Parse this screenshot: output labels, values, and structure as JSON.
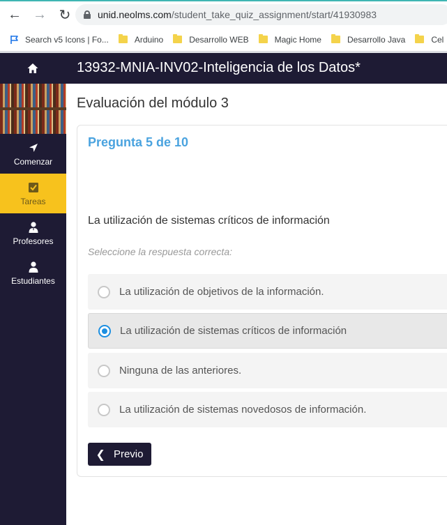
{
  "browser": {
    "url_host": "unid.neolms.com",
    "url_path": "/student_take_quiz_assignment/start/41930983",
    "bookmarks": [
      {
        "label": "Search v5 Icons | Fo...",
        "icon": "flag-icon"
      },
      {
        "label": "Arduino",
        "icon": "folder-icon"
      },
      {
        "label": "Desarrollo WEB",
        "icon": "folder-icon"
      },
      {
        "label": "Magic Home",
        "icon": "folder-icon"
      },
      {
        "label": "Desarrollo Java",
        "icon": "folder-icon"
      },
      {
        "label": "Cel",
        "icon": "folder-icon"
      }
    ]
  },
  "header": {
    "course_title": "13932-MNIA-INV02-Inteligencia de los Datos*"
  },
  "sidebar": {
    "items": [
      {
        "label": "Comenzar",
        "icon": "paper-plane-icon"
      },
      {
        "label": "Tareas",
        "icon": "checkbox-icon"
      },
      {
        "label": "Profesores",
        "icon": "teacher-icon"
      },
      {
        "label": "Estudiantes",
        "icon": "student-icon"
      }
    ]
  },
  "main": {
    "page_title": "Evaluación del módulo 3",
    "question_number": "Pregunta 5 de 10",
    "question_text": "La utilización de sistemas críticos de información",
    "hint": "Seleccione la respuesta correcta:",
    "options": [
      {
        "label": "La utilización de objetivos de la información.",
        "selected": false
      },
      {
        "label": "La utilización de sistemas críticos de información",
        "selected": true
      },
      {
        "label": "Ninguna de las anteriores.",
        "selected": false
      },
      {
        "label": "La utilización de sistemas novedosos de información.",
        "selected": false
      }
    ],
    "prev_label": "Previo"
  },
  "colors": {
    "dark_navy": "#1e1b34",
    "accent_yellow": "#f7c21d",
    "question_blue": "#4aa3df",
    "radio_blue": "#1d8fe1"
  }
}
